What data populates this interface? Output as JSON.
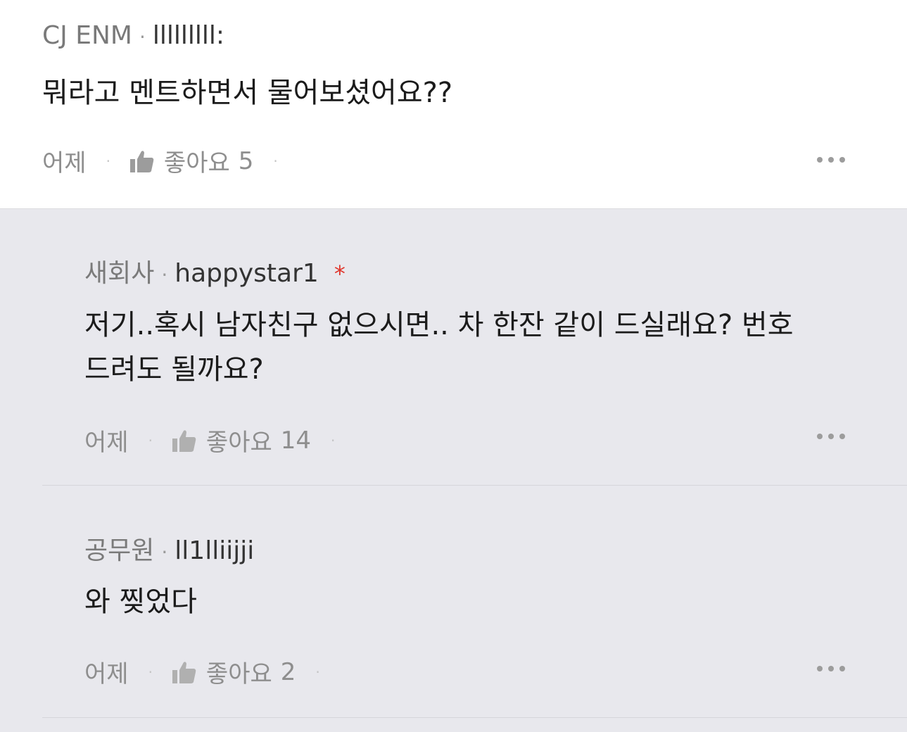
{
  "main_comment": {
    "company": "CJ ENM",
    "nickname": "lllllllll:",
    "text": "뭐라고 멘트하면서 물어보셨어요??",
    "time": "어제",
    "like_label": "좋아요",
    "like_count": "5"
  },
  "replies": [
    {
      "company": "새회사",
      "nickname": "happystar1",
      "star": "*",
      "text_line1": "저기..혹시 남자친구 없으시면.. 차 한잔 같이 드실래요?  번호",
      "text_line2": "드려도 될까요?",
      "time": "어제",
      "like_label": "좋아요",
      "like_count": "14"
    },
    {
      "company": "공무원",
      "nickname": "ll1llii̇jji",
      "text_line1": "와 찢었다",
      "time": "어제",
      "like_label": "좋아요",
      "like_count": "2"
    }
  ],
  "separator": "·",
  "icons": {
    "like": "thumbs-up-icon",
    "more": "more-horizontal-icon"
  },
  "colors": {
    "reply_background": "#e8e8ed",
    "star_accent": "#e0352b"
  }
}
